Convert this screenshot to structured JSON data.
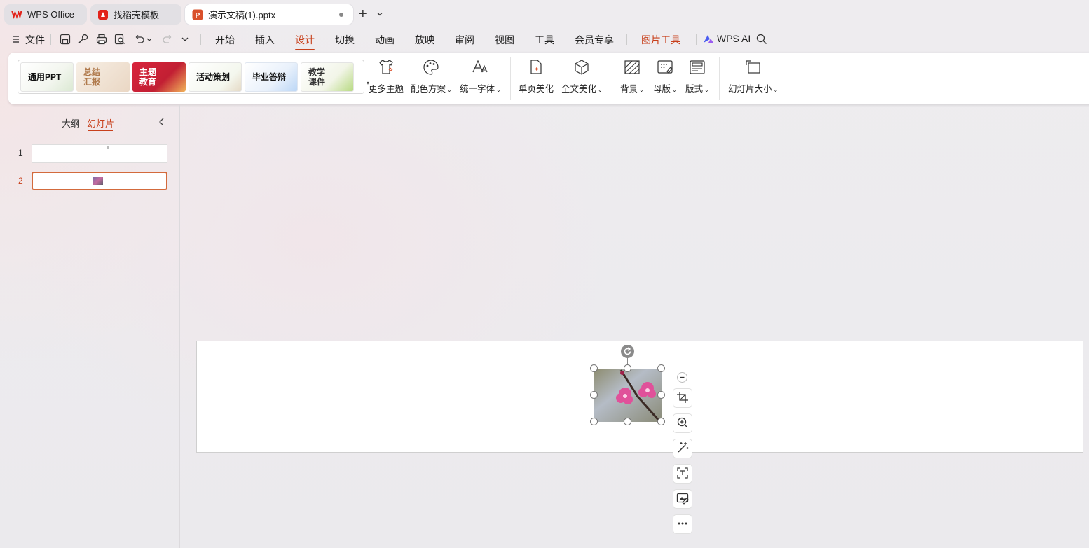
{
  "tabs": [
    {
      "label": "WPS Office",
      "icon": "wps-logo-icon"
    },
    {
      "label": "找稻壳模板",
      "icon": "docer-logo-icon"
    },
    {
      "label": "演示文稿(1).pptx",
      "icon": "ppt-logo-icon",
      "active": true
    }
  ],
  "menubar": {
    "file_label": "文件",
    "items": [
      "开始",
      "插入",
      "设计",
      "切换",
      "动画",
      "放映",
      "审阅",
      "视图",
      "工具",
      "会员专享"
    ],
    "active": "设计",
    "picture_tools": "图片工具",
    "wps_ai": "WPS AI"
  },
  "ribbon": {
    "themes": [
      "通用PPT",
      "总结\n汇报",
      "主题\n教育",
      "活动策划",
      "毕业答辩",
      "教学\n课件"
    ],
    "buttons": {
      "more_themes": "更多主题",
      "color_scheme": "配色方案",
      "unify_font": "统一字体",
      "single_beautify": "单页美化",
      "full_beautify": "全文美化",
      "background": "背景",
      "master": "母版",
      "layout": "版式",
      "slide_size": "幻灯片大小"
    }
  },
  "leftpanel": {
    "tab_outline": "大纲",
    "tab_slides": "幻灯片",
    "slides": [
      "1",
      "2"
    ],
    "selected": "2"
  },
  "colors": {
    "accent": "#c8401c",
    "wps_red": "#e2231a"
  }
}
